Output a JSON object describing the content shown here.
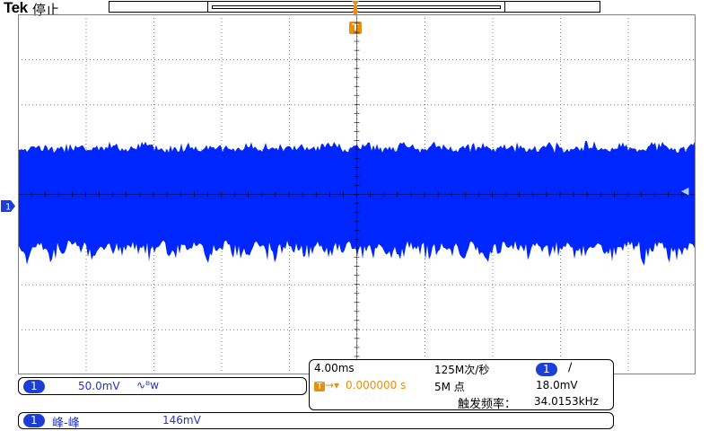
{
  "header": {
    "brand": "Tek",
    "status": "停止"
  },
  "trigger_marker": "T",
  "channel_marker": "1",
  "colors": {
    "waveform": "#0026ff",
    "trigger": "#e8900c",
    "badge": "#1c3dd6",
    "grid": "#808080"
  },
  "vertical": {
    "channel": "1",
    "scale": "50.0mV",
    "coupling_icon": "∿ᴮw"
  },
  "horizontal": {
    "time_per_div": "4.00ms",
    "sample_rate": "125M次/秒",
    "trigger_channel": "1",
    "trigger_slope": "∕",
    "trigger_delay": "0.000000 s",
    "record_length": "5M 点",
    "trigger_level": "18.0mV",
    "freq_label": "触发频率：",
    "freq_value": "34.0153kHz"
  },
  "measurement": {
    "channel": "1",
    "name": "峰-峰",
    "value": "146mV"
  }
}
